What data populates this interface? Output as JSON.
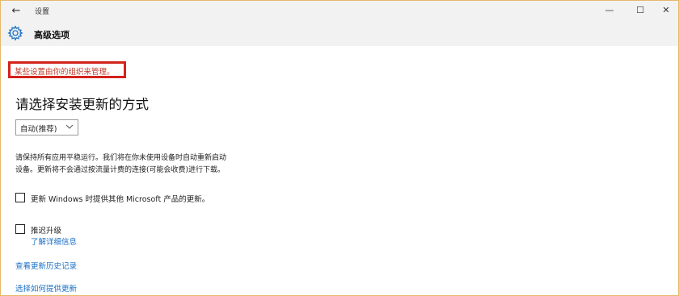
{
  "window": {
    "title": "设置",
    "back_label": "←",
    "minimize_label": "—",
    "maximize_label": "☐",
    "close_label": "✕"
  },
  "header": {
    "icon": "gear-icon",
    "title": "高级选项"
  },
  "notice": {
    "text": "某些设置由你的组织来管理。",
    "highlight_color": "#d3231b"
  },
  "main": {
    "heading": "请选择安装更新的方式",
    "install_mode": {
      "selected": "自动(推荐)"
    },
    "description_line1": "请保持所有应用平稳运行。我们将在你未使用设备时自动重新启动",
    "description_line2": "设备。更新将不会通过按流量计费的连接(可能会收费)进行下载。",
    "options": [
      {
        "label": "更新 Windows 时提供其他 Microsoft 产品的更新。",
        "checked": false
      },
      {
        "label": "推迟升级",
        "checked": false
      }
    ],
    "learn_more_link": "了解详细信息",
    "history_link": "查看更新历史记录",
    "delivery_link": "选择如何提供更新"
  },
  "colors": {
    "link": "#1a6fc4",
    "notice_text": "#c0392b",
    "chrome": "#f2f2f2"
  }
}
